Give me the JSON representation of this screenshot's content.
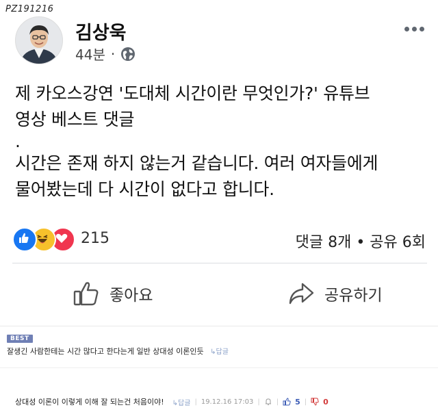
{
  "watermark": "PZ191216",
  "post": {
    "author": "김상욱",
    "time": "44분",
    "dot": "·",
    "lines": [
      "제 카오스강연 '도대체 시간이란 무엇인가?' 유튜브",
      "영상 베스트 댓글",
      ".",
      "시간은 존재 하지 않는거 같습니다. 여러 여자들에게",
      "물어봤는데 다 시간이 없다고 합니다."
    ]
  },
  "reactions": {
    "count": "215",
    "icons": [
      "like-icon",
      "haha-icon",
      "love-icon"
    ],
    "stats": "댓글 8개 • 공유 6회"
  },
  "actions": {
    "like": "좋아요",
    "share": "공유하기"
  },
  "comments": {
    "best_badge": "BEST",
    "best_text": "잘생긴 사람한테는 시간 많다고 한다는게 일반 상대성 이론인듯",
    "reply_label": "↳답글",
    "second": {
      "text": "상대성 이론이 이렇게 이해 잘 되는건 처음이야!",
      "reply_label": "↳답글",
      "date": "19.12.16 17:03",
      "upvotes": "5",
      "downvotes": "0"
    }
  },
  "colors": {
    "like_blue": "#1877f2",
    "haha_yellow": "#f7c12b",
    "love_red": "#f0364f",
    "upvote": "#3b5bb5",
    "downvote": "#d23a3a"
  }
}
